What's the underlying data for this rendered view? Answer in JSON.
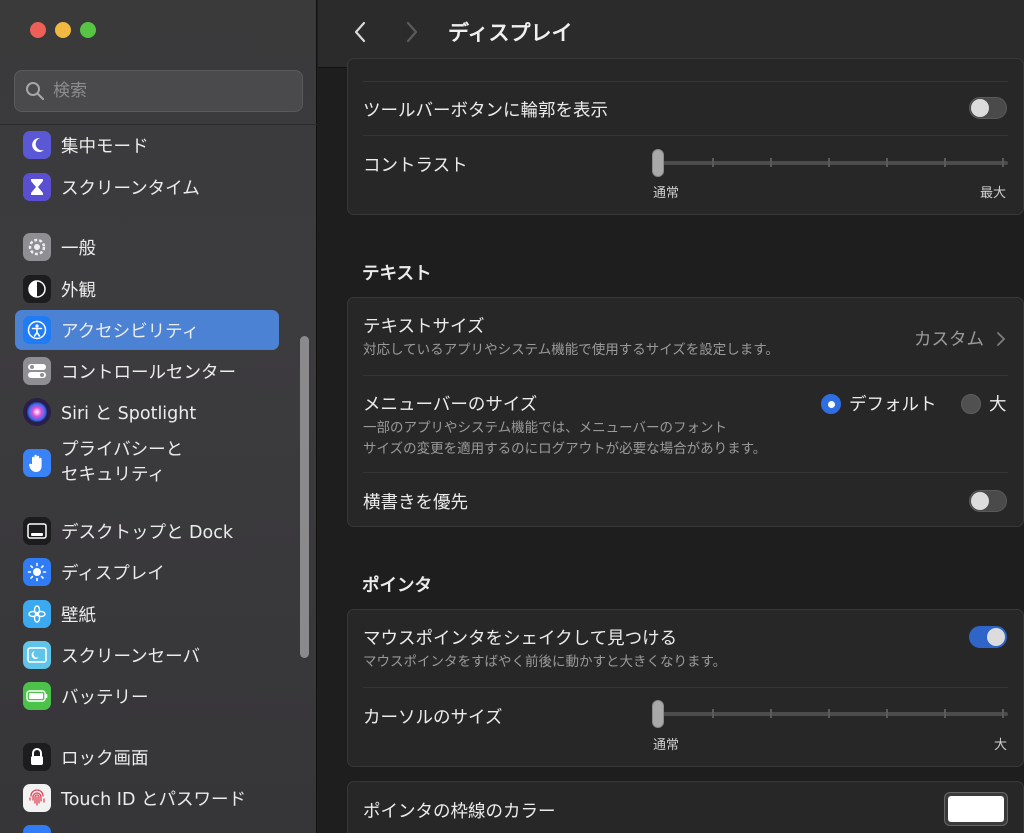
{
  "window": {
    "title": "ディスプレイ"
  },
  "sidebar": {
    "search_placeholder": "検索",
    "items": [
      {
        "label": "集中モード",
        "icon": "moon-icon",
        "color": "#5b58d6"
      },
      {
        "label": "スクリーンタイム",
        "icon": "hourglass-icon",
        "color": "#5b4fd1"
      },
      {
        "label": "一般",
        "icon": "gear-icon",
        "color": "#8e8e93"
      },
      {
        "label": "外観",
        "icon": "appearance-icon",
        "color": "#1c1c1e"
      },
      {
        "label": "アクセシビリティ",
        "icon": "accessibility-icon",
        "color": "#1f7cf4",
        "selected": true
      },
      {
        "label": "コントロールセンター",
        "icon": "control-center-icon",
        "color": "#8e8e93"
      },
      {
        "label": "Siri と Spotlight",
        "icon": "siri-icon",
        "color": "#2b1e4a"
      },
      {
        "label": "プライバシーと\nセキュリティ",
        "icon": "hand-icon",
        "color": "#3a82f7"
      },
      {
        "label": "デスクトップと Dock",
        "icon": "dock-icon",
        "color": "#1c1c1e"
      },
      {
        "label": "ディスプレイ",
        "icon": "sun-icon",
        "color": "#2f7cf6"
      },
      {
        "label": "壁紙",
        "icon": "flower-icon",
        "color": "#3aa9f0"
      },
      {
        "label": "スクリーンセーバ",
        "icon": "screensaver-icon",
        "color": "#5fc4e8"
      },
      {
        "label": "バッテリー",
        "icon": "battery-icon",
        "color": "#4cc24a"
      },
      {
        "label": "ロック画面",
        "icon": "lock-icon",
        "color": "#1c1c1e"
      },
      {
        "label": "Touch ID とパスワード",
        "icon": "fingerprint-icon",
        "color": "#f2f2f2"
      }
    ]
  },
  "main": {
    "group1": {
      "toolbar_outline_label": "ツールバーボタンに輪郭を表示",
      "toolbar_outline_on": false,
      "contrast_label": "コントラスト",
      "contrast_min": "通常",
      "contrast_max": "最大",
      "contrast_value": 0
    },
    "text_section": {
      "heading": "テキスト",
      "text_size_label": "テキストサイズ",
      "text_size_desc": "対応しているアプリやシステム機能で使用するサイズを設定します。",
      "text_size_value": "カスタム",
      "menubar_label": "メニューバーのサイズ",
      "menubar_desc_1": "一部のアプリやシステム機能では、メニューバーのフォント",
      "menubar_desc_2": "サイズの変更を適用するのにログアウトが必要な場合があります。",
      "menubar_option_default": "デフォルト",
      "menubar_option_large": "大",
      "menubar_selected": "default",
      "horizontal_label": "横書きを優先",
      "horizontal_on": false
    },
    "pointer_section": {
      "heading": "ポインタ",
      "shake_label": "マウスポインタをシェイクして見つける",
      "shake_desc": "マウスポインタをすばやく前後に動かすと大きくなります。",
      "shake_on": true,
      "cursor_size_label": "カーソルのサイズ",
      "cursor_min": "通常",
      "cursor_max": "大",
      "cursor_value": 0,
      "outline_color_label": "ポインタの枠線のカラー",
      "outline_color": "#ffffff"
    }
  }
}
